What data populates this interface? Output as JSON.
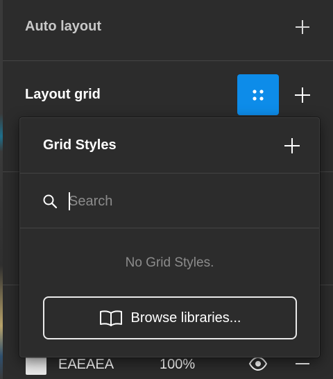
{
  "auto_layout": {
    "title": "Auto layout",
    "add_icon": "plus-icon"
  },
  "layout_grid": {
    "title": "Layout grid",
    "styles_icon": "grid-styles-icon",
    "add_icon": "plus-icon"
  },
  "grid_styles_popover": {
    "title": "Grid Styles",
    "add_icon": "plus-icon",
    "search": {
      "placeholder": "Search",
      "value": "",
      "icon": "search-icon"
    },
    "empty_message": "No Grid Styles.",
    "browse_button": {
      "label": "Browse libraries...",
      "icon": "book-icon"
    }
  },
  "fill": {
    "hex": "EAEAEA",
    "opacity": "100%",
    "swatch_color": "#EAEAEA",
    "visibility_icon": "eye-icon",
    "remove_icon": "minus-icon"
  },
  "colors": {
    "panel_bg": "#2C2C2C",
    "accent_blue": "#0D8CE9",
    "muted_text": "#8C8C8C",
    "section_title_muted": "#C8C8C8"
  }
}
